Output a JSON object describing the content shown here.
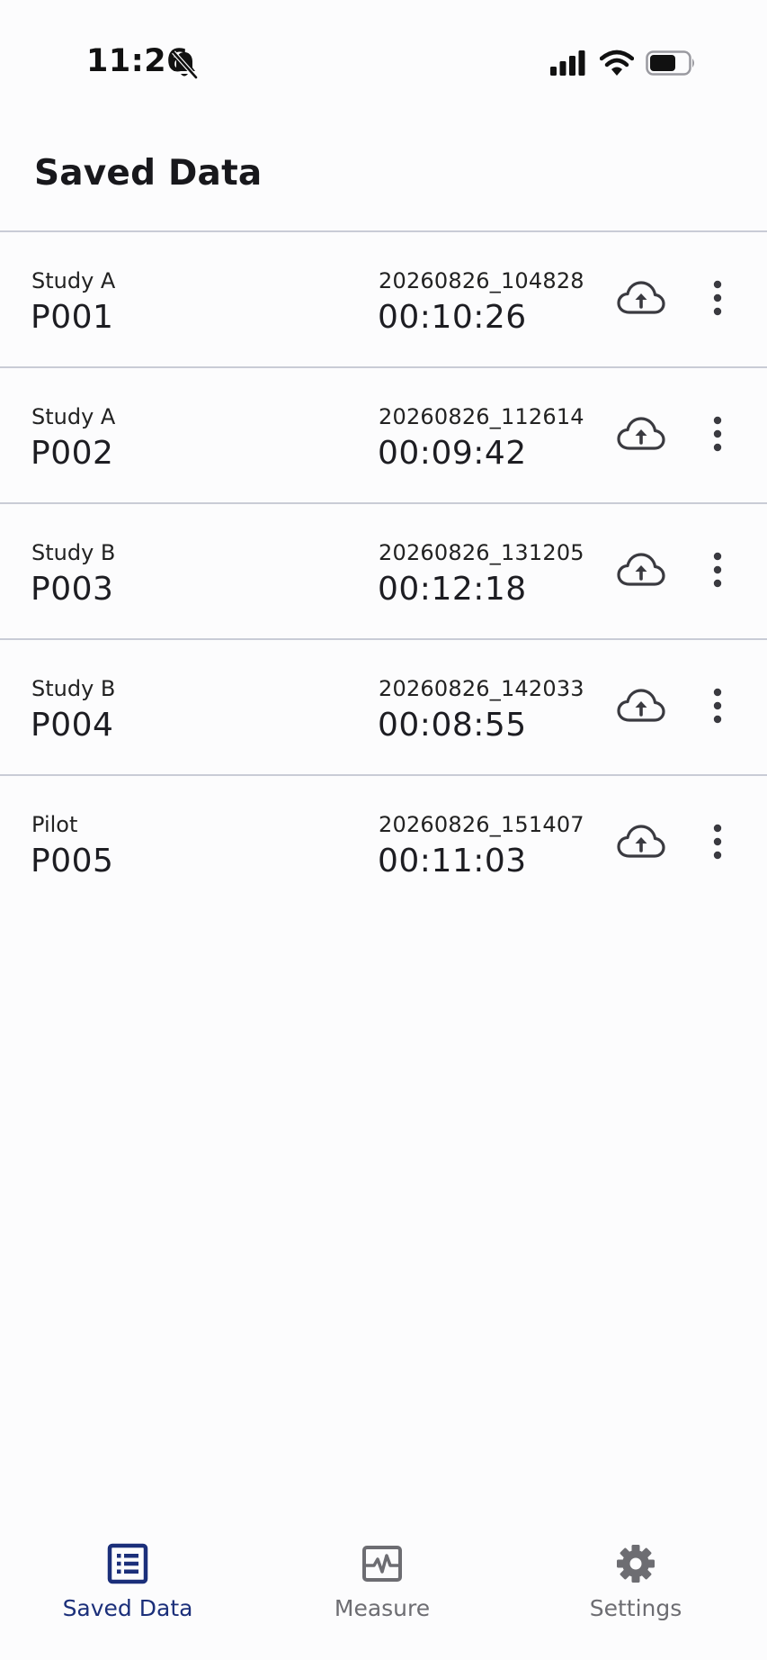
{
  "status_bar": {
    "time": "11:26"
  },
  "header": {
    "title": "Saved Data"
  },
  "colors": {
    "accent": "#1b2f7a",
    "inactive": "#6d6d72",
    "divider": "#c9ccd6"
  },
  "records": [
    {
      "study": "Study A",
      "participant": "P001",
      "file": "20260826_104828",
      "duration": "00:10:26"
    },
    {
      "study": "Study A",
      "participant": "P002",
      "file": "20260826_112614",
      "duration": "00:09:42"
    },
    {
      "study": "Study B",
      "participant": "P003",
      "file": "20260826_131205",
      "duration": "00:12:18"
    },
    {
      "study": "Study B",
      "participant": "P004",
      "file": "20260826_142033",
      "duration": "00:08:55"
    },
    {
      "study": "Pilot",
      "participant": "P005",
      "file": "20260826_151407",
      "duration": "00:11:03"
    }
  ],
  "row_icons": {
    "upload": "cloud-upload-icon",
    "more": "more-vertical-icon"
  },
  "bottom_nav": {
    "items": [
      {
        "label": "Saved Data",
        "icon": "list-icon",
        "active": true
      },
      {
        "label": "Measure",
        "icon": "waveform-icon",
        "active": false
      },
      {
        "label": "Settings",
        "icon": "gear-icon",
        "active": false
      }
    ]
  }
}
